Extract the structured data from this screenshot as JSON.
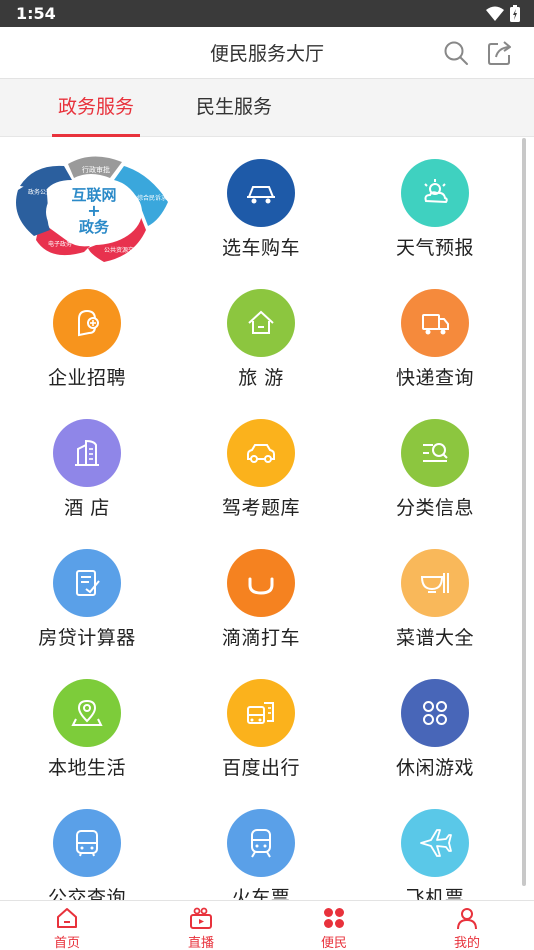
{
  "status_bar": {
    "time": "1:54"
  },
  "header": {
    "title": "便民服务大厅"
  },
  "tabs": [
    {
      "label": "政务服务",
      "active": true
    },
    {
      "label": "民生服务",
      "active": false
    }
  ],
  "featured": {
    "center_line1": "互联网",
    "center_line2": "+",
    "center_line3": "政务",
    "segments": [
      "行政审批",
      "综合民诉求",
      "公共资源交易",
      "电子政务",
      "政务公开"
    ]
  },
  "services": [
    {
      "label": "选车购车",
      "icon": "car-icon",
      "color": "#1e5aa8"
    },
    {
      "label": "天气预报",
      "icon": "weather-icon",
      "color": "#3fd1c0"
    },
    {
      "label": "企业招聘",
      "icon": "recruit-icon",
      "color": "#f7941d"
    },
    {
      "label": "旅 游",
      "icon": "house-icon",
      "color": "#8cc63f"
    },
    {
      "label": "快递查询",
      "icon": "truck-icon",
      "color": "#f58a3c"
    },
    {
      "label": "酒 店",
      "icon": "building-icon",
      "color": "#8f86e8"
    },
    {
      "label": "驾考题库",
      "icon": "car-outline-icon",
      "color": "#fbb21c"
    },
    {
      "label": "分类信息",
      "icon": "list-search-icon",
      "color": "#8cc63f"
    },
    {
      "label": "房贷计算器",
      "icon": "calculator-doc-icon",
      "color": "#5aa0e8"
    },
    {
      "label": "滴滴打车",
      "icon": "didi-icon",
      "color": "#f58220"
    },
    {
      "label": "菜谱大全",
      "icon": "bowl-icon",
      "color": "#f9b85a"
    },
    {
      "label": "本地生活",
      "icon": "location-pin-icon",
      "color": "#7dcc3a"
    },
    {
      "label": "百度出行",
      "icon": "bus-map-icon",
      "color": "#fbb21c"
    },
    {
      "label": "休闲游戏",
      "icon": "clover-icon",
      "color": "#4866b8"
    },
    {
      "label": "公交查询",
      "icon": "bus-icon",
      "color": "#5aa0e8"
    },
    {
      "label": "火车票",
      "icon": "train-icon",
      "color": "#5aa0e8"
    },
    {
      "label": "飞机票",
      "icon": "plane-icon",
      "color": "#5ac8e8"
    }
  ],
  "bottom_nav": [
    {
      "label": "首页",
      "icon": "home-icon"
    },
    {
      "label": "直播",
      "icon": "live-tv-icon"
    },
    {
      "label": "便民",
      "icon": "convenience-icon",
      "active": true
    },
    {
      "label": "我的",
      "icon": "user-icon"
    }
  ],
  "colors": {
    "accent": "#e8323c",
    "statusbar": "#3a3a3a"
  }
}
